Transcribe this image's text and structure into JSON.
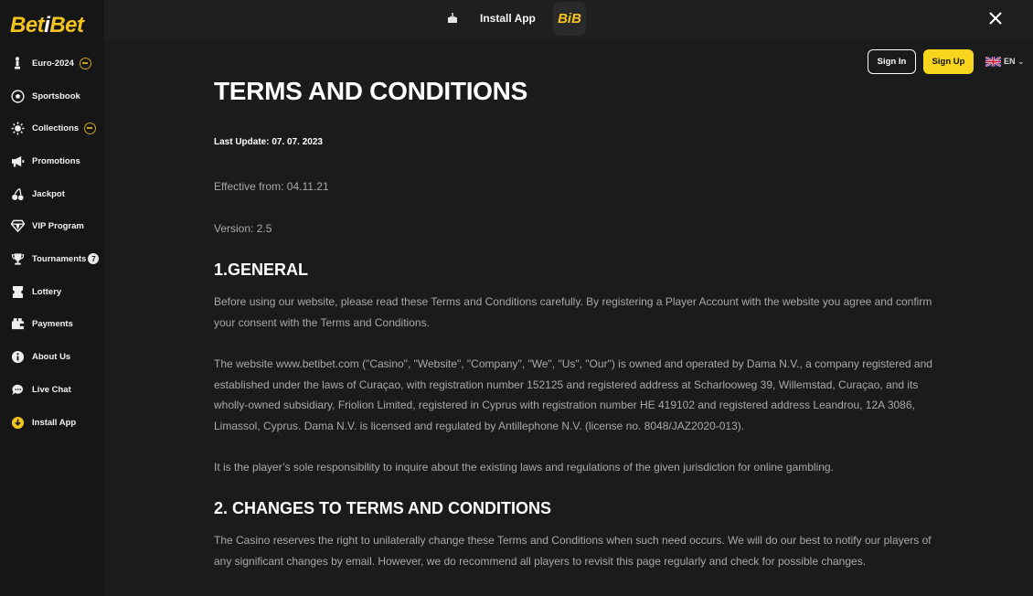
{
  "sidebar": {
    "logo_part1": "Bet",
    "logo_part2": "i",
    "logo_part3": "Bet",
    "items": [
      {
        "label": "Euro-2024",
        "icon": "trophy-figure-icon"
      },
      {
        "label": "Sportsbook",
        "icon": "soccer-ball-icon"
      },
      {
        "label": "Collections",
        "icon": "sun-icon"
      },
      {
        "label": "Promotions",
        "icon": "megaphone-icon"
      },
      {
        "label": "Jackpot",
        "icon": "cherries-icon"
      },
      {
        "label": "VIP Program",
        "icon": "diamond-icon"
      },
      {
        "label": "Tournaments",
        "icon": "cup-icon",
        "badge": "7"
      },
      {
        "label": "Lottery",
        "icon": "ticket-icon"
      },
      {
        "label": "Payments",
        "icon": "wallet-icon"
      },
      {
        "label": "About Us",
        "icon": "info-icon"
      },
      {
        "label": "Live Chat",
        "icon": "chat-icon"
      },
      {
        "label": "Install App",
        "icon": "download-icon"
      }
    ]
  },
  "banner": {
    "install_label": "Install App",
    "logo_text": "BiB"
  },
  "header": {
    "signin_label": "Sign In",
    "signup_label": "Sign Up",
    "lang_label": "EN"
  },
  "content": {
    "title": "TERMS AND CONDITIONS",
    "last_update": "Last Update: 07. 07. 2023",
    "effective": "Effective from: 04.11.21",
    "version": "Version: 2.5",
    "section1_title": "1.GENERAL",
    "section1_p1": "Before using our website, please read these Terms and Conditions carefully. By registering a Player Account with the website you agree and confirm your consent with the Terms and Conditions.",
    "section1_p2": "The website www.betibet.com (\"Casino\", \"Website\", \"Company\", \"We\", \"Us\", \"Our\") is owned and operated by Dama N.V., a company registered and established under the laws of Curaçao, with registration number 152125 and registered address at Scharlooweg 39, Willemstad, Curaçao, and its wholly-owned subsidiary, Friolion Limited, registered in Cyprus with registration number HE 419102 and registered address Leandrou, 12A 3086, Limassol, Cyprus. Dama N.V. is licensed and regulated by Antillephone N.V. (license no. 8048/JAZ2020-013).",
    "section1_p3": "It is the player’s sole responsibility to inquire about the existing laws and regulations of the given jurisdiction for online gambling.",
    "section2_title": "2. CHANGES TO TERMS AND CONDITIONS",
    "section2_p1": "The Casino reserves the right to unilaterally change these Terms and Conditions when such need occurs. We will do our best to notify our players of any significant changes by email. However, we do recommend all players to revisit this page regularly and check for possible changes."
  },
  "colors": {
    "accent": "#f7d51c",
    "background": "#1b1b1b",
    "sidebar": "#161616"
  }
}
